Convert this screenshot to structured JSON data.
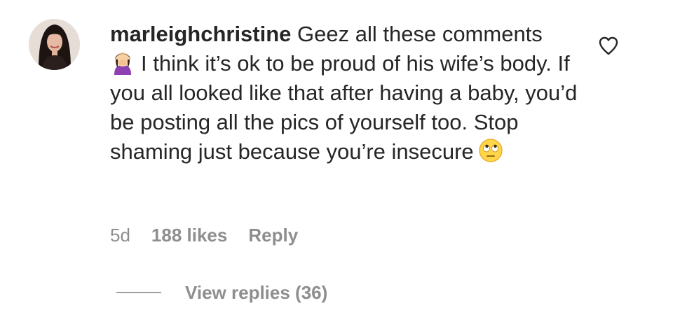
{
  "comment": {
    "username": "marleighchristine",
    "text_line1_rest": " Geez all these comments",
    "text_after_first_emoji": "I think it’s ok to be proud of his wife’s body. If you all looked like that after having a baby, you’d be posting all the pics of yourself too. Stop shaming just because you’re insecure",
    "emoji_lead": "woman-facepalming-emoji",
    "emoji_trail": "face-with-rolling-eyes-emoji"
  },
  "meta": {
    "time": "5d",
    "likes": "188 likes",
    "reply": "Reply"
  },
  "view_replies": {
    "label": "View replies (36)"
  },
  "icons": {
    "like": "heart-outline-icon",
    "avatar": "profile-photo"
  },
  "colors": {
    "text": "#262626",
    "secondary": "#8e8e8e",
    "background": "#ffffff"
  }
}
